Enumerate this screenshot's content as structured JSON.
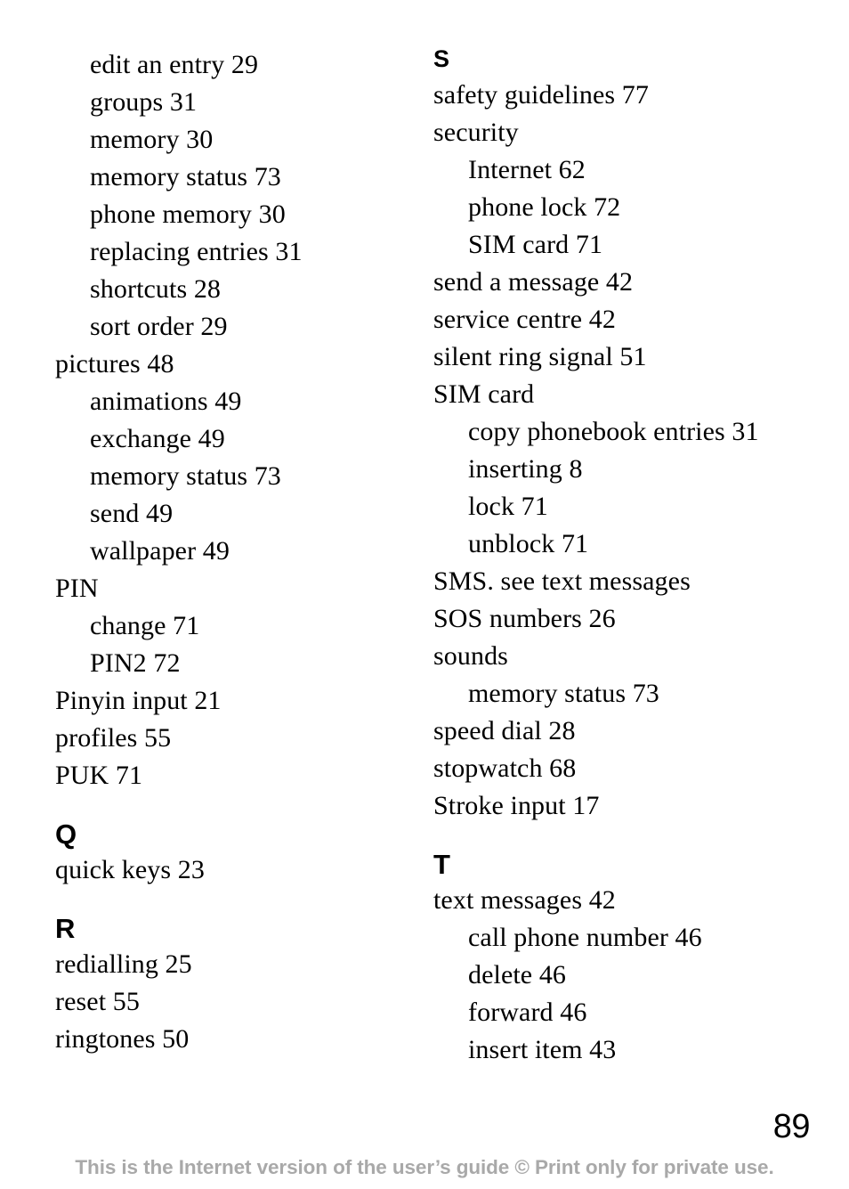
{
  "document": {
    "page_number": "89",
    "footer_text": "This is the Internet version of the user’s guide © Print only for private use.",
    "footer_color": "#a9a9a9",
    "text_color": "#000000",
    "background_color": "#ffffff"
  },
  "columns": {
    "left": {
      "entries": [
        {
          "text": "edit an entry 29",
          "level": 2
        },
        {
          "text": "groups 31",
          "level": 2
        },
        {
          "text": "memory 30",
          "level": 2
        },
        {
          "text": "memory status 73",
          "level": 2
        },
        {
          "text": "phone memory 30",
          "level": 2
        },
        {
          "text": "replacing entries 31",
          "level": 2
        },
        {
          "text": "shortcuts 28",
          "level": 2
        },
        {
          "text": "sort order 29",
          "level": 2
        },
        {
          "text": "pictures 48",
          "level": 1
        },
        {
          "text": "animations 49",
          "level": 2
        },
        {
          "text": "exchange 49",
          "level": 2
        },
        {
          "text": "memory status 73",
          "level": 2
        },
        {
          "text": "send 49",
          "level": 2
        },
        {
          "text": "wallpaper 49",
          "level": 2
        },
        {
          "text": "PIN",
          "level": 1
        },
        {
          "text": "change 71",
          "level": 2
        },
        {
          "text": "PIN2 72",
          "level": 2
        },
        {
          "text": "Pinyin input 21",
          "level": 1
        },
        {
          "text": "profiles 55",
          "level": 1
        },
        {
          "text": "PUK 71",
          "level": 1
        }
      ],
      "sections": [
        {
          "letter": "Q",
          "entries": [
            {
              "text": "quick keys 23",
              "level": 1
            }
          ]
        },
        {
          "letter": "R",
          "entries": [
            {
              "text": "redialling 25",
              "level": 1
            },
            {
              "text": "reset 55",
              "level": 1
            },
            {
              "text": "ringtones 50",
              "level": 1
            }
          ]
        }
      ]
    },
    "right": {
      "sections": [
        {
          "letter": "S",
          "entries": [
            {
              "text": "safety guidelines 77",
              "level": 1
            },
            {
              "text": "security",
              "level": 1
            },
            {
              "text": "Internet 62",
              "level": 2
            },
            {
              "text": "phone lock 72",
              "level": 2
            },
            {
              "text": "SIM card 71",
              "level": 2
            },
            {
              "text": "send a message 42",
              "level": 1
            },
            {
              "text": "service centre 42",
              "level": 1
            },
            {
              "text": "silent ring signal 51",
              "level": 1
            },
            {
              "text": "SIM card",
              "level": 1
            },
            {
              "text": "copy phonebook entries 31",
              "level": 2
            },
            {
              "text": "inserting 8",
              "level": 2
            },
            {
              "text": "lock 71",
              "level": 2
            },
            {
              "text": "unblock 71",
              "level": 2
            },
            {
              "text": "SMS. see text messages",
              "level": 1
            },
            {
              "text": "SOS numbers 26",
              "level": 1
            },
            {
              "text": "sounds",
              "level": 1
            },
            {
              "text": "memory status 73",
              "level": 2
            },
            {
              "text": "speed dial 28",
              "level": 1
            },
            {
              "text": "stopwatch 68",
              "level": 1
            },
            {
              "text": "Stroke input 17",
              "level": 1
            }
          ]
        },
        {
          "letter": "T",
          "entries": [
            {
              "text": "text messages 42",
              "level": 1
            },
            {
              "text": "call phone number 46",
              "level": 2
            },
            {
              "text": "delete 46",
              "level": 2
            },
            {
              "text": "forward 46",
              "level": 2
            },
            {
              "text": "insert item 43",
              "level": 2
            }
          ]
        }
      ]
    }
  }
}
